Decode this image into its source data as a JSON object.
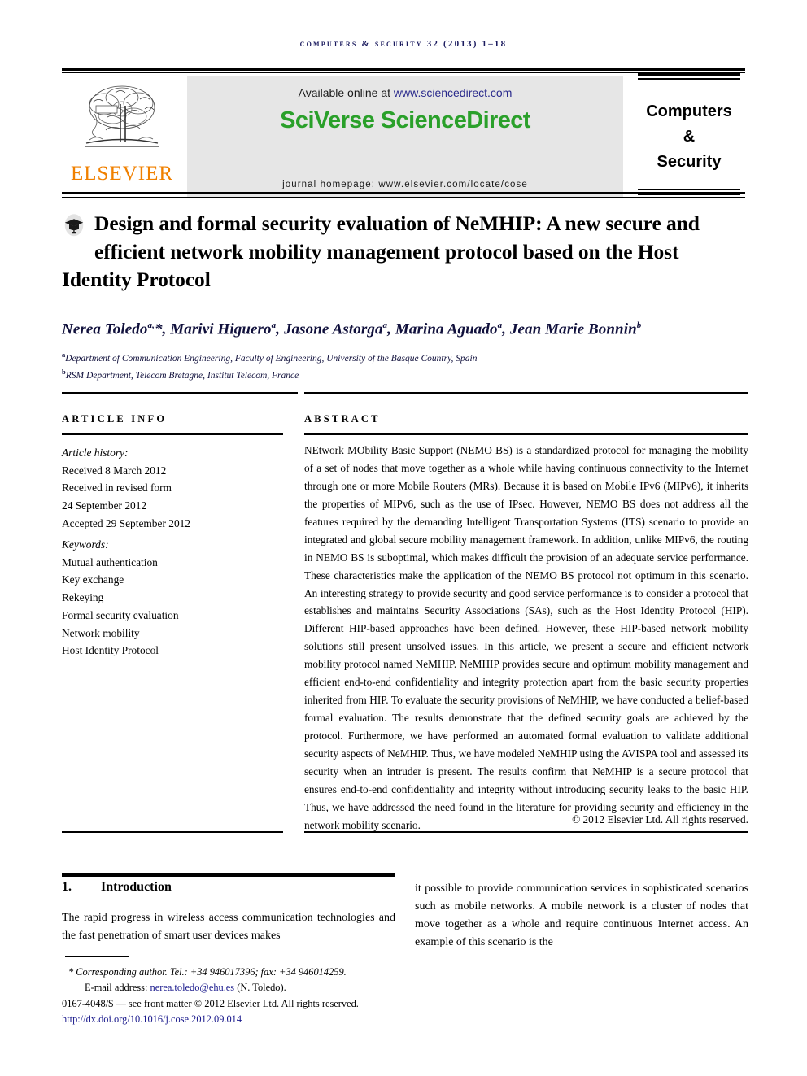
{
  "running_head": "Computers & Security 32 (2013) 1–18",
  "masthead": {
    "publisher_name": "ELSEVIER",
    "available_prefix": "Available online at ",
    "available_url": "www.sciencedirect.com",
    "brand_sciverse": "SciVerse",
    "brand_sciencedirect": "ScienceDirect",
    "homepage": "journal homepage: www.elsevier.com/locate/cose",
    "journal_line1": "Computers",
    "journal_line2": "&",
    "journal_line3": "Security"
  },
  "article": {
    "title": "Design and formal security evaluation of NeMHIP: A new secure and efficient network mobility management protocol based on the Host Identity Protocol",
    "authors_html": "Nerea Toledo<sup>a,</sup>*, Marivi Higuero<sup>a</sup>, Jasone Astorga<sup>a</sup>, Marina Aguado<sup>a</sup>, Jean Marie Bonnin<sup>b</sup>",
    "affiliation_a": "Department of Communication Engineering, Faculty of Engineering, University of the Basque Country, Spain",
    "affiliation_b": "RSM Department, Telecom Bretagne, Institut Telecom, France",
    "affiliation_a_marker": "a",
    "affiliation_b_marker": "b"
  },
  "info": {
    "heading": "ARTICLE INFO",
    "history_label": "Article history:",
    "history": [
      "Received 8 March 2012",
      "Received in revised form",
      "24 September 2012",
      "Accepted 29 September 2012"
    ],
    "keywords_label": "Keywords:",
    "keywords": [
      "Mutual authentication",
      "Key exchange",
      "Rekeying",
      "Formal security evaluation",
      "Network mobility",
      "Host Identity Protocol"
    ]
  },
  "abstract": {
    "heading": "ABSTRACT",
    "text": "NEtwork MObility Basic Support (NEMO BS) is a standardized protocol for managing the mobility of a set of nodes that move together as a whole while having continuous connectivity to the Internet through one or more Mobile Routers (MRs). Because it is based on Mobile IPv6 (MIPv6), it inherits the properties of MIPv6, such as the use of IPsec. However, NEMO BS does not address all the features required by the demanding Intelligent Transportation Systems (ITS) scenario to provide an integrated and global secure mobility management framework. In addition, unlike MIPv6, the routing in NEMO BS is suboptimal, which makes difficult the provision of an adequate service performance. These characteristics make the application of the NEMO BS protocol not optimum in this scenario. An interesting strategy to provide security and good service performance is to consider a protocol that establishes and maintains Security Associations (SAs), such as the Host Identity Protocol (HIP). Different HIP-based approaches have been defined. However, these HIP-based network mobility solutions still present unsolved issues. In this article, we present a secure and efficient network mobility protocol named NeMHIP. NeMHIP provides secure and optimum mobility management and efficient end-to-end confidentiality and integrity protection apart from the basic security properties inherited from HIP. To evaluate the security provisions of NeMHIP, we have conducted a belief-based formal evaluation. The results demonstrate that the defined security goals are achieved by the protocol. Furthermore, we have performed an automated formal evaluation to validate additional security aspects of NeMHIP. Thus, we have modeled NeMHIP using the AVISPA tool and assessed its security when an intruder is present. The results confirm that NeMHIP is a secure protocol that ensures end-to-end confidentiality and integrity without introducing security leaks to the basic HIP. Thus, we have addressed the need found in the literature for providing security and efficiency in the network mobility scenario.",
    "copyright": "© 2012 Elsevier Ltd. All rights reserved."
  },
  "body": {
    "section_number": "1.",
    "section_title": "Introduction",
    "column_left": "The rapid progress in wireless access communication technologies and the fast penetration of smart user devices makes",
    "column_right": "it possible to provide communication services in sophisticated scenarios such as mobile networks. A mobile network is a cluster of nodes that move together as a whole and require continuous Internet access. An example of this scenario is the"
  },
  "footer": {
    "corresponding": "* Corresponding author. Tel.: +34 946017396; fax: +34 946014259.",
    "email_label": "E-mail address: ",
    "email": "nerea.toledo@ehu.es",
    "email_suffix": " (N. Toledo).",
    "issn_line": "0167-4048/$ — see front matter © 2012 Elsevier Ltd. All rights reserved.",
    "doi": "http://dx.doi.org/10.1016/j.cose.2012.09.014"
  },
  "colors": {
    "elsevier_orange": "#f08000",
    "sciencedirect_green": "#2aa02a",
    "link_blue": "#1a1a8c",
    "author_navy": "#10103c",
    "banner_gray": "#e6e6e6"
  }
}
